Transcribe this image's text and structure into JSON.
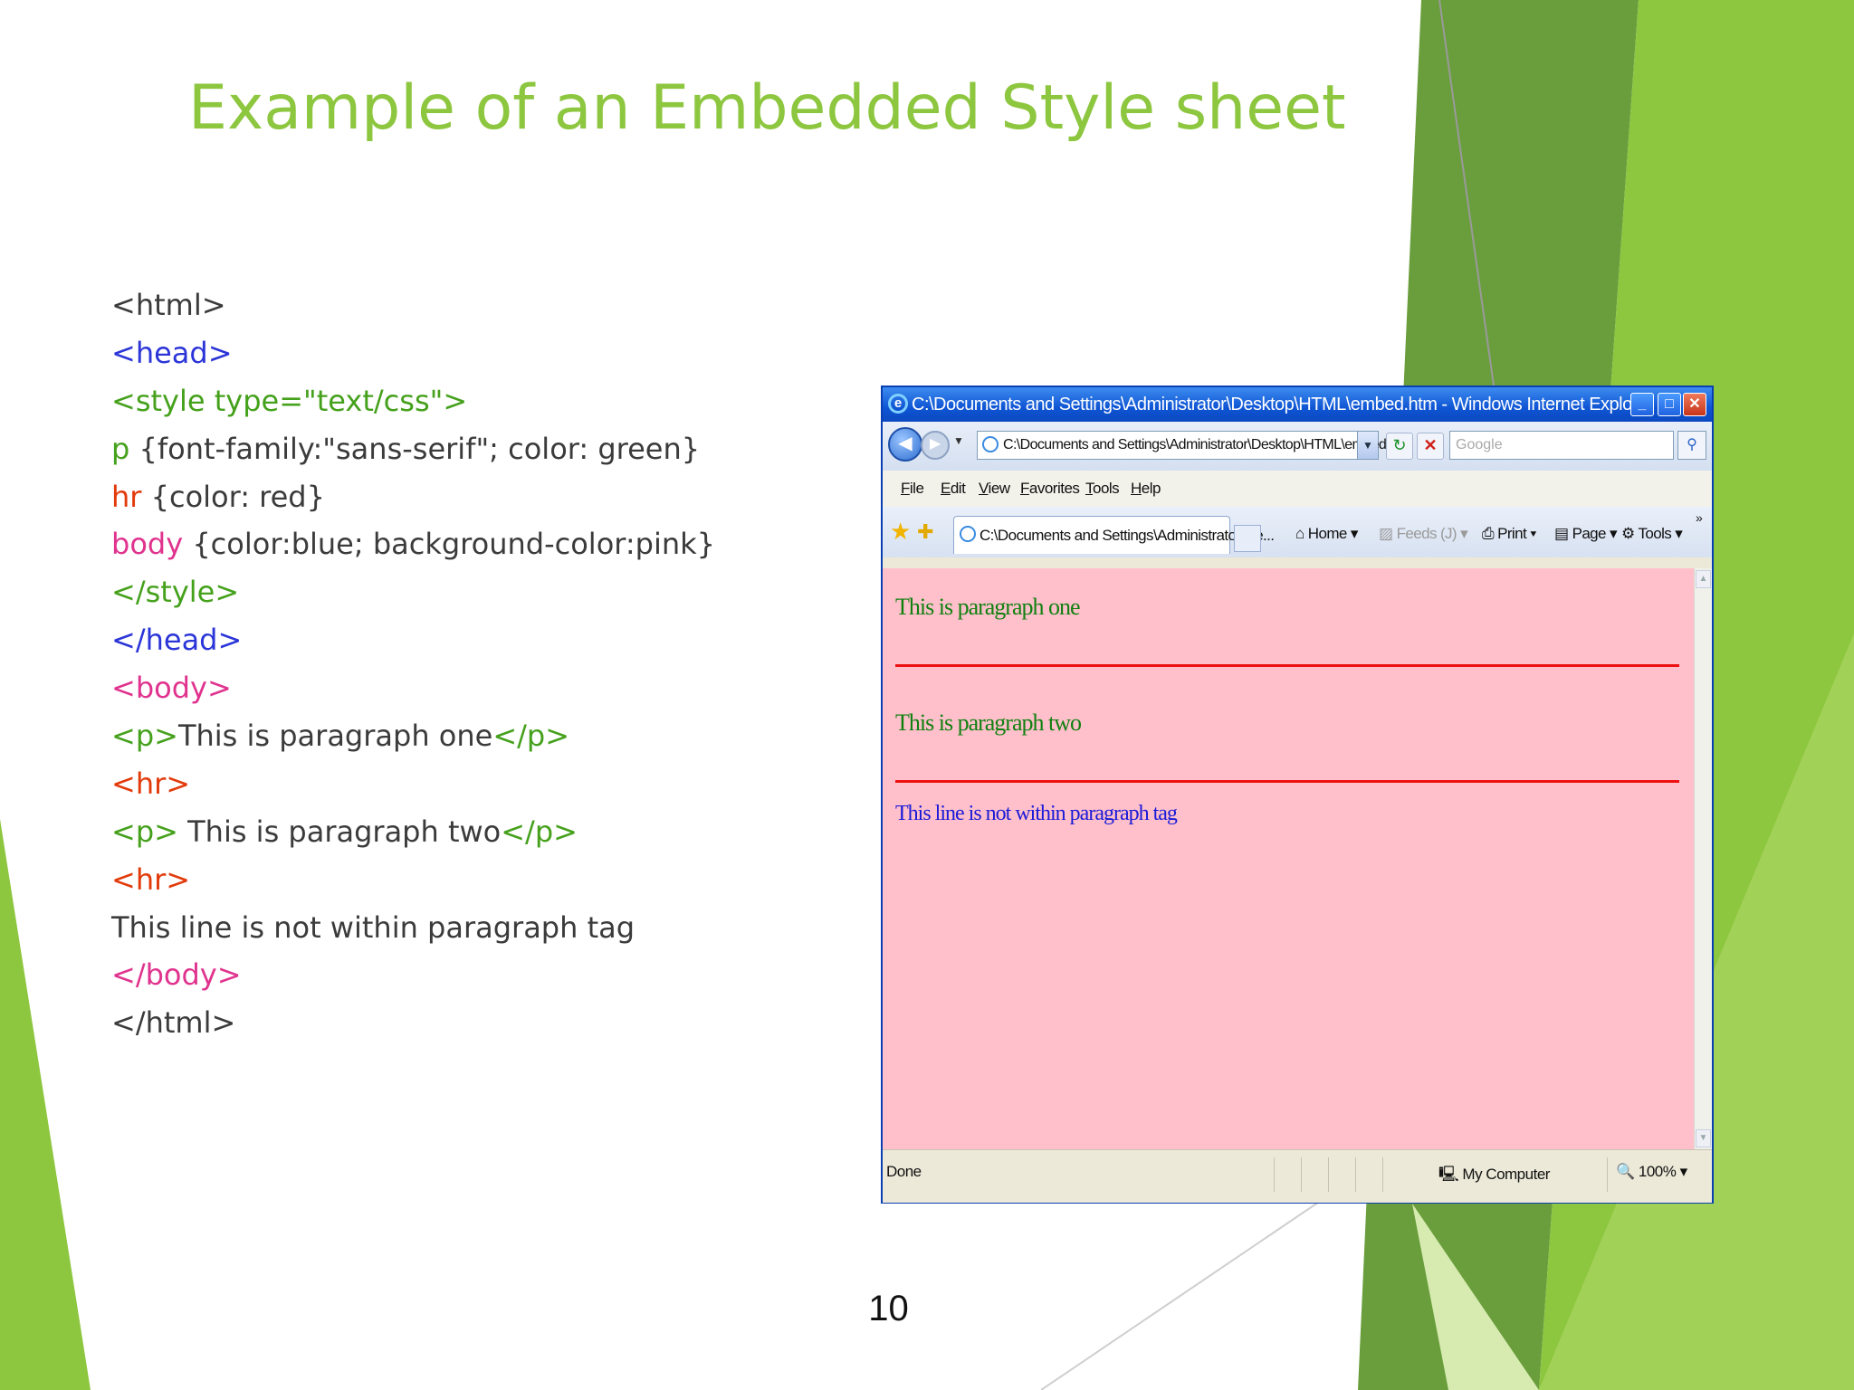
{
  "slide": {
    "title": "Example of an Embedded Style sheet",
    "page_number": "10",
    "accent_color": "#8dc63f"
  },
  "code_lines": [
    {
      "parts": [
        {
          "text": "<html>",
          "color": "dark"
        }
      ]
    },
    {
      "parts": [
        {
          "text": "<head>",
          "color": "blue"
        }
      ]
    },
    {
      "parts": [
        {
          "text": "<style type=\"text/css\">",
          "color": "green"
        }
      ]
    },
    {
      "parts": [
        {
          "text": "p",
          "color": "green"
        },
        {
          "text": " {font-family:\"sans-serif\"; color: green}",
          "color": "dark"
        }
      ]
    },
    {
      "parts": [
        {
          "text": "hr",
          "color": "red"
        },
        {
          "text": " {color: red}",
          "color": "dark"
        }
      ]
    },
    {
      "parts": [
        {
          "text": "body",
          "color": "pink"
        },
        {
          "text": " {color:blue; background-color:pink}",
          "color": "dark"
        }
      ]
    },
    {
      "parts": [
        {
          "text": "</style>",
          "color": "green"
        }
      ]
    },
    {
      "parts": [
        {
          "text": "</head>",
          "color": "blue"
        }
      ]
    },
    {
      "parts": [
        {
          "text": "<body>",
          "color": "pink"
        }
      ]
    },
    {
      "parts": [
        {
          "text": "<p>",
          "color": "green"
        },
        {
          "text": "This is paragraph one",
          "color": "dark"
        },
        {
          "text": "</p>",
          "color": "green"
        }
      ]
    },
    {
      "parts": [
        {
          "text": "<hr>",
          "color": "red"
        }
      ]
    },
    {
      "parts": [
        {
          "text": "<p>",
          "color": "green"
        },
        {
          "text": " This is paragraph two",
          "color": "dark"
        },
        {
          "text": "</p>",
          "color": "green"
        }
      ]
    },
    {
      "parts": [
        {
          "text": "<hr>",
          "color": "red"
        }
      ]
    },
    {
      "parts": [
        {
          "text": "This line is not within paragraph tag",
          "color": "dark"
        }
      ]
    },
    {
      "parts": [
        {
          "text": "</body>",
          "color": "pink"
        }
      ]
    },
    {
      "parts": [
        {
          "text": "</html>",
          "color": "dark"
        }
      ]
    }
  ],
  "browser": {
    "window_title": "C:\\Documents and Settings\\Administrator\\Desktop\\HTML\\embed.htm - Windows Internet Explorer",
    "address": "C:\\Documents and Settings\\Administrator\\Desktop\\HTML\\embed.htm",
    "search_placeholder": "Google",
    "menu": [
      "File",
      "Edit",
      "View",
      "Favorites",
      "Tools",
      "Help"
    ],
    "tab_title": "C:\\Documents and Settings\\Administrator\\De...",
    "commands": {
      "home": "Home",
      "feeds": "Feeds (J)",
      "print": "Print",
      "page": "Page",
      "tools": "Tools"
    },
    "content": {
      "paragraph_one": "This is paragraph one",
      "paragraph_two": "This is paragraph two",
      "line_three": "This line is not within paragraph tag",
      "background_color": "#ffc0cb",
      "paragraph_color": "#108010",
      "rule_color": "#ee1111",
      "body_text_color": "#1a1ad8"
    },
    "status": {
      "left": "Done",
      "zone": "My Computer",
      "zoom": "100%"
    }
  }
}
